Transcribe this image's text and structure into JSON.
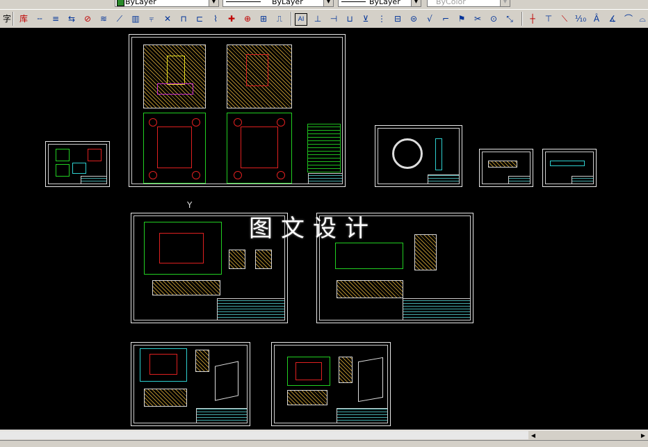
{
  "properties_toolbar": {
    "layer_value": "ByLayer",
    "linetype_value": "ByLayer",
    "lineweight_value": "ByLayer",
    "plotstyle_value": "ByColor"
  },
  "left_partial_label": "字",
  "toolbar_icons": [
    "库",
    "pin-icon",
    "align-icon",
    "connect-icon",
    "no-entry-icon",
    "spring-icon",
    "diagonal-icon",
    "mold-base-icon",
    "ejector-icon",
    "cross-icon",
    "circle-target-icon",
    "gate-icon",
    "text-style-icon",
    "dimension-icon",
    "tolerance-icon",
    "weld-icon",
    "number-icon",
    "table-icon",
    "balloon-icon",
    "roughness-icon",
    "leader-icon",
    "scissors-icon",
    "flag-icon",
    "crosshair-icon",
    "centerline-icon",
    "slash-icon",
    "tenth-icon",
    "A-icon",
    "datum-icon",
    "marker-icon"
  ],
  "watermark": "图文设计",
  "ucs_mark": "Y"
}
